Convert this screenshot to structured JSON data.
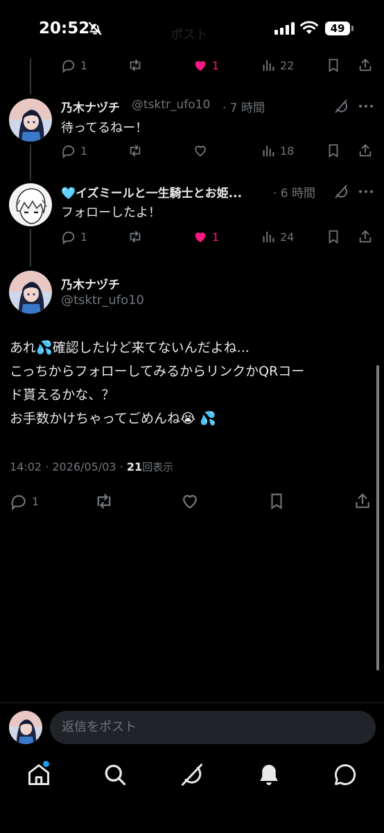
{
  "status_bar": {
    "time": "20:52",
    "battery": "49",
    "header_title": "ポスト"
  },
  "tweets": [
    {
      "actions": {
        "reply": "1",
        "retweet": "",
        "like": "1",
        "views": "22"
      },
      "liked": true
    },
    {
      "name": "乃木ナヅチ",
      "handle": "@tsktr_ufo10",
      "time": "· 7 時間",
      "text": "待ってるねー！",
      "actions": {
        "reply": "1",
        "retweet": "",
        "like": "",
        "views": "18"
      },
      "liked": false
    },
    {
      "name": "🩵イズミールと一生騎士とお姫...",
      "time": "· 6 時間",
      "text": "フォローしたよ！",
      "actions": {
        "reply": "1",
        "retweet": "",
        "like": "1",
        "views": "24"
      },
      "liked": true
    }
  ],
  "main_tweet": {
    "name": "乃木ナヅチ",
    "handle": "@tsktr_ufo10",
    "lines": [
      "あれ💦確認したけど来てないんだよね...",
      "こっちからフォローしてみるからリンクかQRコー",
      "ド貰えるかな、？",
      "お手数かけちゃってごめんね😭 💦"
    ],
    "timestamp": "14:02 · 2026/05/03 · ",
    "views_count": "21",
    "views_label": "回表示",
    "reply_count": "1"
  },
  "reply_bar": {
    "placeholder": "返信をポスト"
  },
  "colors": {
    "like": "#f91880",
    "accent": "#1d9bf0",
    "muted": "#71767b"
  }
}
